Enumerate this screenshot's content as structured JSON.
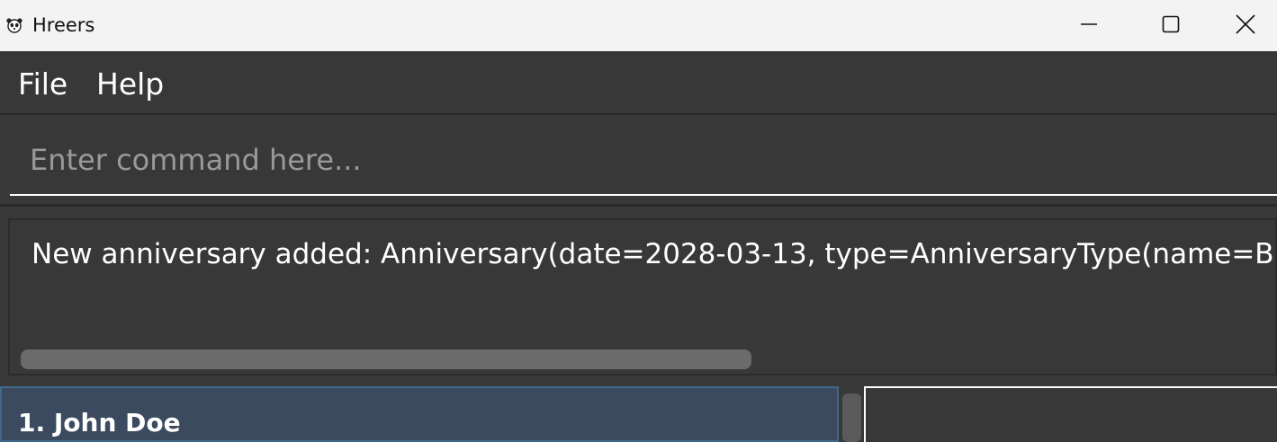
{
  "window": {
    "title": "Hreers",
    "icon": "panda-icon",
    "controls": [
      "minimize-icon",
      "maximize-icon",
      "close-icon"
    ]
  },
  "menu": {
    "items": [
      {
        "label": "File"
      },
      {
        "label": "Help"
      }
    ]
  },
  "command": {
    "placeholder": "Enter command here..."
  },
  "result": {
    "text": "New anniversary added: Anniversary(date=2028-03-13, type=AnniversaryType(name=Birthday, d"
  },
  "persons": [
    {
      "index_name": "1. John Doe"
    }
  ],
  "colors": {
    "background": "#383838",
    "titlebar": "#f3f3f3",
    "selected_card": "#3c4a5f",
    "text": "#ffffff"
  }
}
